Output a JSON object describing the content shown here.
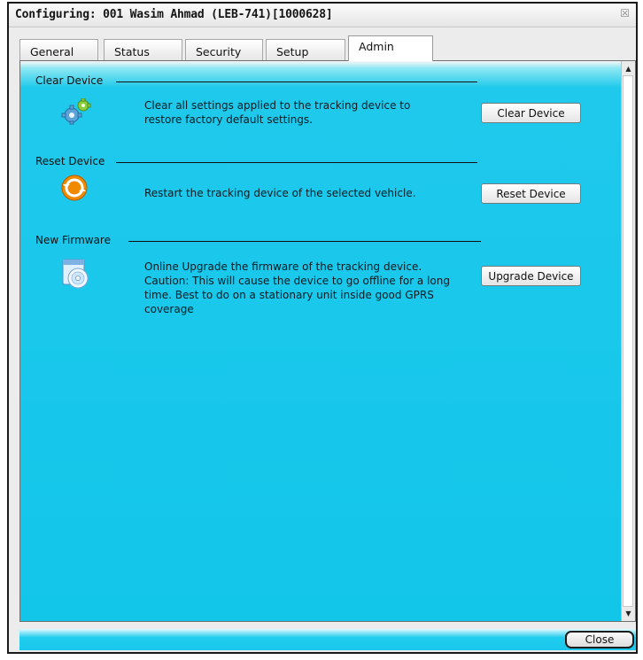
{
  "window": {
    "title": "Configuring: 001 Wasim Ahmad (LEB-741)[1000628]",
    "close_glyph": "☒"
  },
  "tabs": [
    {
      "label": "General",
      "active": false
    },
    {
      "label": "Status",
      "active": false
    },
    {
      "label": "Security",
      "active": false
    },
    {
      "label": "Setup",
      "active": false
    },
    {
      "label": "Admin",
      "active": true
    }
  ],
  "sections": {
    "clear": {
      "label": "Clear Device",
      "description": "Clear all settings applied to the tracking device to restore factory default settings.",
      "button": "Clear Device",
      "icon": "gears-icon"
    },
    "reset": {
      "label": "Reset Device",
      "description": "Restart the tracking device of the selected vehicle.",
      "button": "Reset Device",
      "icon": "restart-icon"
    },
    "firmware": {
      "label": "New Firmware",
      "description": "Online Upgrade the firmware of the tracking device. Caution: This will cause the device to go offline for a long time. Best to do on a stationary unit inside good GPRS coverage",
      "button": "Upgrade Device",
      "icon": "firmware-disc-icon"
    }
  },
  "footer": {
    "close_label": "Close"
  },
  "colors": {
    "panel": "#12c6ea",
    "accent_orange": "#f28a00"
  }
}
